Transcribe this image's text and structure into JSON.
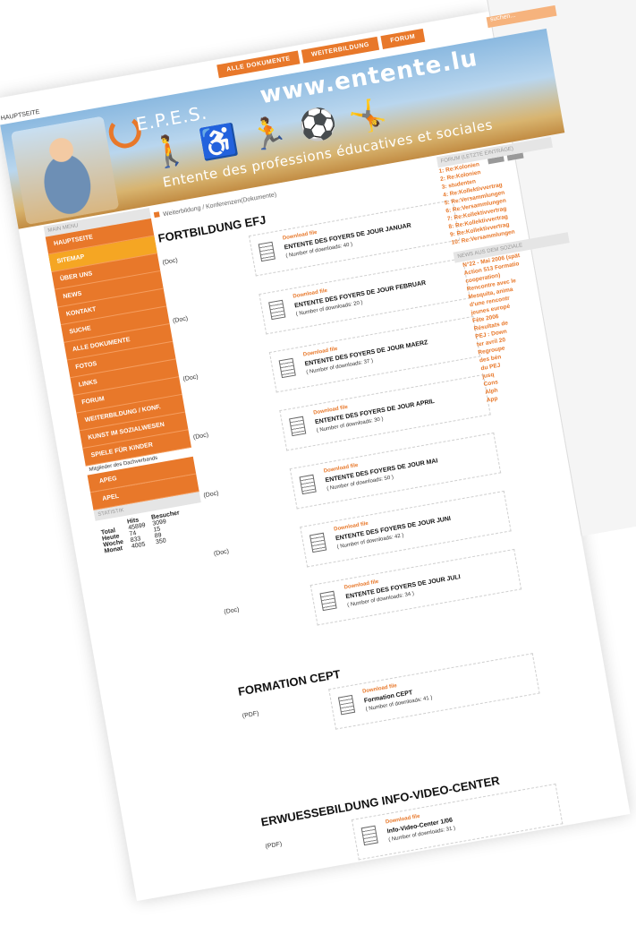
{
  "topnav": [
    "ALLE DOKUMENTE",
    "WEITERBILDUNG",
    "FORUM"
  ],
  "search_placeholder": "suchen...",
  "hauptseite": "HAUPTSEITE",
  "banner": {
    "logo": "E.P.E.S.",
    "url": "www.entente.lu",
    "tagline": "Entente des professions éducatives et sociales"
  },
  "sidebar": {
    "header": "MAIN MENU",
    "items": [
      "HAUPTSEITE",
      "SITEMAP",
      "ÜBER UNS",
      "NEWS",
      "KONTAKT",
      "SUCHE",
      "ALLE DOKUMENTE",
      "FOTOS",
      "LINKS",
      "FORUM",
      "WEITERBILDUNG / KONF.",
      "KUNST IM SOZIALWESEN",
      "SPIELE FÜR KINDER"
    ],
    "active_index": 1,
    "mitglieder": "Mitglieder des Dachverbands",
    "sub_items": [
      "APEG",
      "APEL"
    ],
    "stat_header": "STATISTIK",
    "stat_cols": [
      "Hits",
      "Besucher"
    ],
    "stats": [
      [
        "Total",
        "45899",
        "3099"
      ],
      [
        "Heute",
        "74",
        "15"
      ],
      [
        "Woche",
        "833",
        "89"
      ],
      [
        "Monat",
        "4005",
        "350"
      ]
    ]
  },
  "breadcrumb": "Weiterbildung / Konferenzen(Dokumente)",
  "sections": [
    {
      "title": "FORTBILDUNG EFJ",
      "files": [
        {
          "type": "(Doc)",
          "label": "Download file",
          "name": "ENTENTE DES FOYERS DE JOUR JANUAR",
          "count": "( Number of downloads: 40 )"
        },
        {
          "type": "(Doc)",
          "label": "Download file",
          "name": "ENTENTE DES FOYERS DE JOUR FEBRUAR",
          "count": "( Number of downloads: 20 )"
        },
        {
          "type": "(Doc)",
          "label": "Download file",
          "name": "ENTENTE DES FOYERS DE JOUR MAERZ",
          "count": "( Number of downloads: 37 )"
        },
        {
          "type": "(Doc)",
          "label": "Download file",
          "name": "ENTENTE DES FOYERS DE JOUR APRIL",
          "count": "( Number of downloads: 30 )"
        },
        {
          "type": "(Doc)",
          "label": "Download file",
          "name": "ENTENTE DES FOYERS DE JOUR MAI",
          "count": "( Number of downloads: 50 )"
        },
        {
          "type": "(Doc)",
          "label": "Download file",
          "name": "ENTENTE DES FOYERS DE JOUR JUNI",
          "count": "( Number of downloads: 42 )"
        },
        {
          "type": "(Doc)",
          "label": "Download file",
          "name": "ENTENTE DES FOYERS DE JOUR JULI",
          "count": "( Number of downloads: 34 )"
        }
      ]
    },
    {
      "title": "FORMATION CEPT",
      "files": [
        {
          "type": "(PDF)",
          "label": "Download file",
          "name": "Formation CEPT",
          "count": "( Number of downloads: 41 )"
        }
      ]
    },
    {
      "title": "ERWUESSEBILDUNG INFO-VIDEO-CENTER",
      "files": [
        {
          "type": "(PDF)",
          "label": "Download file",
          "name": "Info-Video-Center 1/06",
          "count": "( Number of downloads: 31 )"
        }
      ]
    }
  ],
  "forum": {
    "header": "FORUM (LETZTE EINTRÄGE)",
    "items": [
      "1: Re:Kolonien",
      "2: Re:Kolonien",
      "3: studenten",
      "4: Re:Kollektivvertrag",
      "5: Re:Versammlungen",
      "6: Re:Versammlungen",
      "7: Re:Kollektivvertrag",
      "8: Re:Kollektivvertrag",
      "9: Re:Kollektivvertrag",
      "10: Re:Versammlungen"
    ]
  },
  "news": {
    "header": "NEWS AUS DEM SOZIALE",
    "items": [
      "N°22 - Mai 2006 (spät",
      "Action 513 Formatio",
      "cooperation)",
      "Rencontre avec le",
      "Mesquita, anima",
      "d'une rencontr",
      "jeunes europé",
      "Fête 2006",
      "Résultats de",
      "PEJ : Down",
      "ter avril 20",
      "Regroupe",
      "des bén",
      "du PEJ",
      "jusq",
      "Cons",
      "Alph",
      "App"
    ]
  }
}
